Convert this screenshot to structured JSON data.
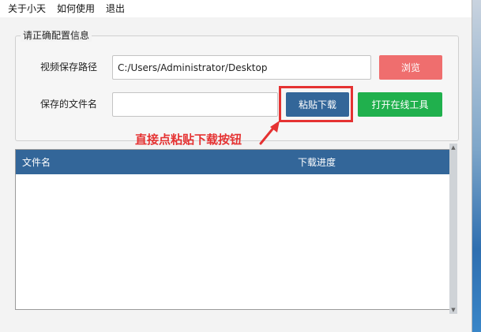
{
  "menu": [
    "关于小天",
    "如何使用",
    "退出"
  ],
  "config": {
    "group_title": "请正确配置信息",
    "path_label": "视频保存路径",
    "path_value": "C:/Users/Administrator/Desktop",
    "browse_label": "浏览",
    "filename_label": "保存的文件名",
    "filename_value": "",
    "paste_label": "粘贴下载",
    "open_tool_label": "打开在线工具"
  },
  "annotation": {
    "text": "直接点粘贴下载按钮",
    "color": "#e53232"
  },
  "list": {
    "columns": [
      "文件名",
      "下载进度"
    ],
    "rows": []
  },
  "colors": {
    "header_blue": "#336699",
    "browse_red": "#ef6e6e",
    "open_green": "#20b04d",
    "annotation_red": "#e53232"
  },
  "icons": {
    "arrow": "arrow-icon",
    "scroll_up": "scroll-up-icon",
    "scroll_down": "scroll-down-icon"
  }
}
